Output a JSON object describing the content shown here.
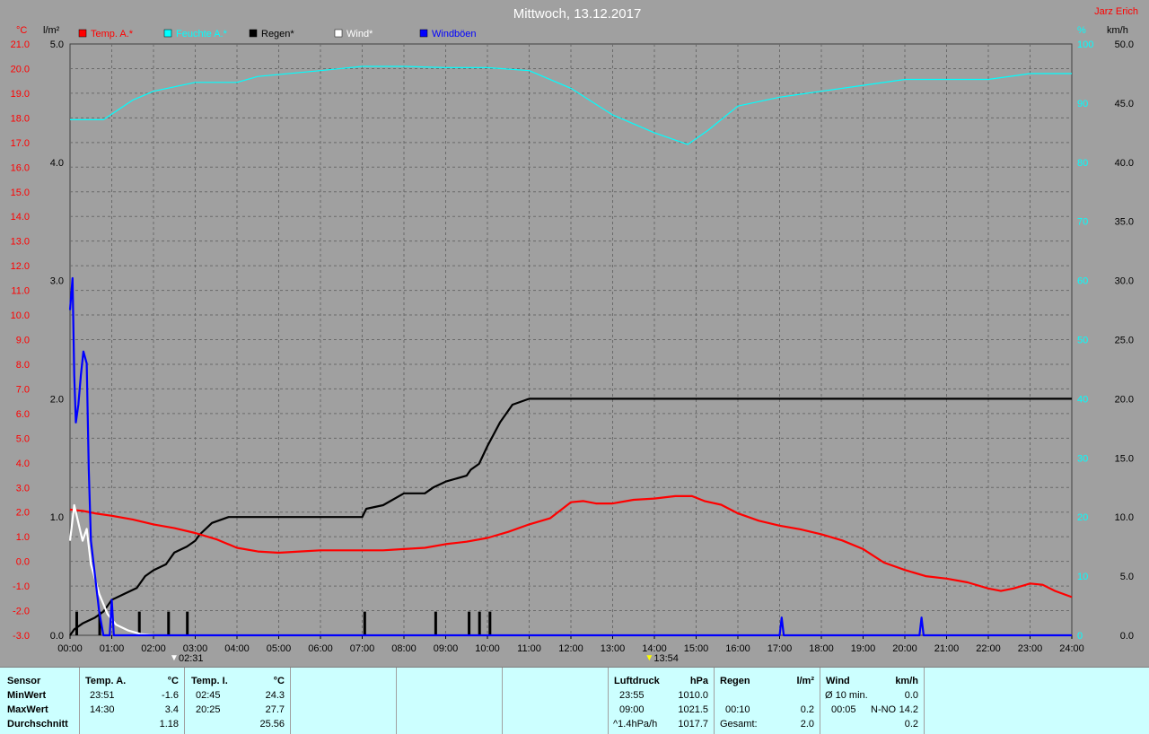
{
  "header": {
    "title": "Mittwoch, 13.12.2017",
    "author": "Jarz Erich"
  },
  "units": {
    "left_temp": "°C",
    "left_rain": "l/m²",
    "right_hum": "%",
    "right_wind": "km/h"
  },
  "legend": [
    {
      "label": "Temp. A.*",
      "color": "#ff0000"
    },
    {
      "label": "Feuchte A.*",
      "color": "#00ffff"
    },
    {
      "label": "Regen*",
      "color": "#000000"
    },
    {
      "label": "Wind*",
      "color": "#ffffff"
    },
    {
      "label": "Windböen",
      "color": "#0000ff"
    }
  ],
  "markers": [
    {
      "time": "02:31",
      "color": "#ffffff"
    },
    {
      "time": "13:54",
      "color": "#ffff00"
    }
  ],
  "chart_data": {
    "type": "line",
    "title": "Mittwoch, 13.12.2017",
    "grid": true,
    "legend_position": "top",
    "x_range": [
      0,
      24
    ],
    "x_ticks": [
      "00:00",
      "01:00",
      "02:00",
      "03:00",
      "04:00",
      "05:00",
      "06:00",
      "07:00",
      "08:00",
      "09:00",
      "10:00",
      "11:00",
      "12:00",
      "13:00",
      "14:00",
      "15:00",
      "16:00",
      "17:00",
      "18:00",
      "19:00",
      "20:00",
      "21:00",
      "22:00",
      "23:00",
      "24:00"
    ],
    "axes": {
      "temp": {
        "label": "°C",
        "range": [
          -3.0,
          21.0
        ],
        "ticks": [
          "21.0",
          "20.0",
          "19.0",
          "18.0",
          "17.0",
          "16.0",
          "15.0",
          "14.0",
          "13.0",
          "12.0",
          "11.0",
          "10.0",
          "9.0",
          "8.0",
          "7.0",
          "6.0",
          "5.0",
          "4.0",
          "3.0",
          "2.0",
          "1.0",
          "0.0",
          "-1.0",
          "-2.0",
          "-3.0"
        ]
      },
      "rain": {
        "label": "l/m²",
        "range": [
          0,
          5.0
        ],
        "ticks": [
          "5.0",
          "4.0",
          "3.0",
          "2.0",
          "1.0",
          "0.0"
        ]
      },
      "humidity": {
        "label": "%",
        "range": [
          0,
          100
        ],
        "ticks": [
          "100",
          "90",
          "80",
          "70",
          "60",
          "50",
          "40",
          "30",
          "20",
          "10",
          "0"
        ]
      },
      "wind": {
        "label": "km/h",
        "range": [
          0,
          50
        ],
        "ticks": [
          "50.0",
          "45.0",
          "40.0",
          "35.0",
          "30.0",
          "25.0",
          "20.0",
          "15.0",
          "10.0",
          "5.0",
          "0.0"
        ]
      }
    },
    "series": [
      {
        "name": "Temp. A.*",
        "axis": "temp",
        "color": "#ff0000",
        "points": [
          [
            0,
            2.1
          ],
          [
            0.3,
            2.05
          ],
          [
            0.6,
            1.95
          ],
          [
            1,
            1.85
          ],
          [
            1.5,
            1.7
          ],
          [
            2,
            1.5
          ],
          [
            2.5,
            1.35
          ],
          [
            3,
            1.15
          ],
          [
            3.5,
            0.9
          ],
          [
            4,
            0.55
          ],
          [
            4.5,
            0.4
          ],
          [
            5,
            0.35
          ],
          [
            5.5,
            0.4
          ],
          [
            6,
            0.45
          ],
          [
            6.5,
            0.45
          ],
          [
            7,
            0.45
          ],
          [
            7.5,
            0.45
          ],
          [
            8,
            0.5
          ],
          [
            8.5,
            0.55
          ],
          [
            9,
            0.7
          ],
          [
            9.5,
            0.8
          ],
          [
            10,
            0.95
          ],
          [
            10.5,
            1.2
          ],
          [
            11,
            1.5
          ],
          [
            11.5,
            1.75
          ],
          [
            12,
            2.4
          ],
          [
            12.3,
            2.45
          ],
          [
            12.6,
            2.35
          ],
          [
            13,
            2.35
          ],
          [
            13.5,
            2.5
          ],
          [
            14,
            2.55
          ],
          [
            14.5,
            2.65
          ],
          [
            14.9,
            2.65
          ],
          [
            15.2,
            2.45
          ],
          [
            15.6,
            2.3
          ],
          [
            16,
            1.95
          ],
          [
            16.5,
            1.65
          ],
          [
            17,
            1.45
          ],
          [
            17.5,
            1.3
          ],
          [
            18,
            1.1
          ],
          [
            18.5,
            0.85
          ],
          [
            19,
            0.5
          ],
          [
            19.5,
            -0.05
          ],
          [
            20,
            -0.35
          ],
          [
            20.5,
            -0.6
          ],
          [
            21,
            -0.7
          ],
          [
            21.5,
            -0.85
          ],
          [
            22,
            -1.1
          ],
          [
            22.3,
            -1.2
          ],
          [
            22.6,
            -1.1
          ],
          [
            23,
            -0.9
          ],
          [
            23.3,
            -0.95
          ],
          [
            23.6,
            -1.2
          ],
          [
            24,
            -1.45
          ]
        ]
      },
      {
        "name": "Feuchte A.*",
        "axis": "humidity",
        "color": "#00ffff",
        "points": [
          [
            0,
            87.2
          ],
          [
            0.8,
            87.2
          ],
          [
            1.5,
            90.5
          ],
          [
            2,
            92
          ],
          [
            3,
            93.5
          ],
          [
            4,
            93.5
          ],
          [
            4.5,
            94.5
          ],
          [
            6,
            95.5
          ],
          [
            7,
            96.2
          ],
          [
            8,
            96.2
          ],
          [
            9,
            96
          ],
          [
            10,
            96
          ],
          [
            11,
            95.5
          ],
          [
            12,
            92.5
          ],
          [
            13,
            88
          ],
          [
            14,
            85
          ],
          [
            14.8,
            83
          ],
          [
            15.3,
            85.5
          ],
          [
            16,
            89.5
          ],
          [
            17,
            91
          ],
          [
            18,
            92
          ],
          [
            19,
            93
          ],
          [
            20,
            94
          ],
          [
            21,
            94
          ],
          [
            22,
            94
          ],
          [
            23,
            95
          ],
          [
            24,
            95
          ]
        ]
      },
      {
        "name": "Regen*",
        "axis": "rain",
        "color": "#000000",
        "points": [
          [
            0,
            0.0
          ],
          [
            0.1,
            0.05
          ],
          [
            0.3,
            0.1
          ],
          [
            0.6,
            0.15
          ],
          [
            0.8,
            0.2
          ],
          [
            1,
            0.3
          ],
          [
            1.3,
            0.35
          ],
          [
            1.6,
            0.4
          ],
          [
            1.8,
            0.5
          ],
          [
            2,
            0.55
          ],
          [
            2.3,
            0.6
          ],
          [
            2.5,
            0.7
          ],
          [
            2.8,
            0.75
          ],
          [
            3,
            0.8
          ],
          [
            3.1,
            0.85
          ],
          [
            3.4,
            0.95
          ],
          [
            3.8,
            1.0
          ],
          [
            4.5,
            1.0
          ],
          [
            5,
            1.0
          ],
          [
            6,
            1.0
          ],
          [
            7,
            1.0
          ],
          [
            7.1,
            1.07
          ],
          [
            7.5,
            1.1
          ],
          [
            8,
            1.2
          ],
          [
            8.5,
            1.2
          ],
          [
            8.7,
            1.25
          ],
          [
            9,
            1.3
          ],
          [
            9.5,
            1.35
          ],
          [
            9.6,
            1.4
          ],
          [
            9.8,
            1.45
          ],
          [
            10,
            1.6
          ],
          [
            10.3,
            1.8
          ],
          [
            10.6,
            1.95
          ],
          [
            11,
            2.0
          ],
          [
            12,
            2.0
          ],
          [
            18,
            2.0
          ],
          [
            24,
            2.0
          ]
        ]
      },
      {
        "name": "Wind*",
        "axis": "wind",
        "color": "#ffffff",
        "points": [
          [
            0,
            8
          ],
          [
            0.1,
            11
          ],
          [
            0.2,
            9.5
          ],
          [
            0.3,
            8
          ],
          [
            0.4,
            9
          ],
          [
            0.5,
            6
          ],
          [
            0.7,
            3.5
          ],
          [
            0.9,
            1.8
          ],
          [
            1.1,
            0.9
          ],
          [
            1.4,
            0.4
          ],
          [
            1.7,
            0.1
          ],
          [
            2,
            0
          ]
        ]
      },
      {
        "name": "Windböen",
        "axis": "wind",
        "color": "#0000ff",
        "points": [
          [
            0,
            27.5
          ],
          [
            0.06,
            30.2
          ],
          [
            0.1,
            22
          ],
          [
            0.14,
            18
          ],
          [
            0.2,
            19.5
          ],
          [
            0.26,
            22
          ],
          [
            0.32,
            24
          ],
          [
            0.4,
            23
          ],
          [
            0.45,
            14
          ],
          [
            0.5,
            8
          ],
          [
            0.6,
            5
          ],
          [
            0.7,
            2
          ],
          [
            0.8,
            0
          ],
          [
            0.95,
            0
          ],
          [
            1,
            3
          ],
          [
            1.05,
            0
          ],
          [
            1.2,
            0
          ],
          [
            17,
            0
          ],
          [
            17.05,
            1.5
          ],
          [
            17.1,
            0
          ],
          [
            20.35,
            0
          ],
          [
            20.4,
            1.5
          ],
          [
            20.45,
            0
          ],
          [
            24,
            0
          ]
        ]
      }
    ],
    "rain_bars": {
      "axis": "rain",
      "color": "#000000",
      "times": [
        0.15,
        0.7,
        1.65,
        2.35,
        2.8,
        7.05,
        8.75,
        9.55,
        9.8,
        10.05
      ]
    }
  },
  "table": {
    "sensor": {
      "header": "Sensor",
      "rows": [
        "MinWert",
        "MaxWert",
        "Durchschnitt"
      ]
    },
    "temp_a": {
      "header": "Temp. A.",
      "unit": "°C",
      "times": [
        "23:51",
        "14:30",
        ""
      ],
      "values": [
        "-1.6",
        "3.4",
        "1.18"
      ]
    },
    "temp_i": {
      "header": "Temp. I.",
      "unit": "°C",
      "times": [
        "02:45",
        "20:25",
        ""
      ],
      "values": [
        "24.3",
        "27.7",
        "25.56"
      ]
    },
    "luftdruck": {
      "header": "Luftdruck",
      "unit": "hPa",
      "times": [
        "23:55",
        "09:00",
        "^1.4hPa/h"
      ],
      "values": [
        "1010.0",
        "1021.5",
        "1017.7"
      ]
    },
    "regen": {
      "header": "Regen",
      "unit": "l/m²",
      "times": [
        "",
        "00:10",
        "Gesamt:"
      ],
      "values": [
        "",
        "0.2",
        "2.0"
      ]
    },
    "wind": {
      "header": "Wind",
      "unit": "km/h",
      "labels": [
        "Ø 10 min.",
        "00:05",
        ""
      ],
      "dirs": [
        "",
        "N-NO",
        ""
      ],
      "values": [
        "0.0",
        "14.2",
        "0.2"
      ]
    }
  }
}
